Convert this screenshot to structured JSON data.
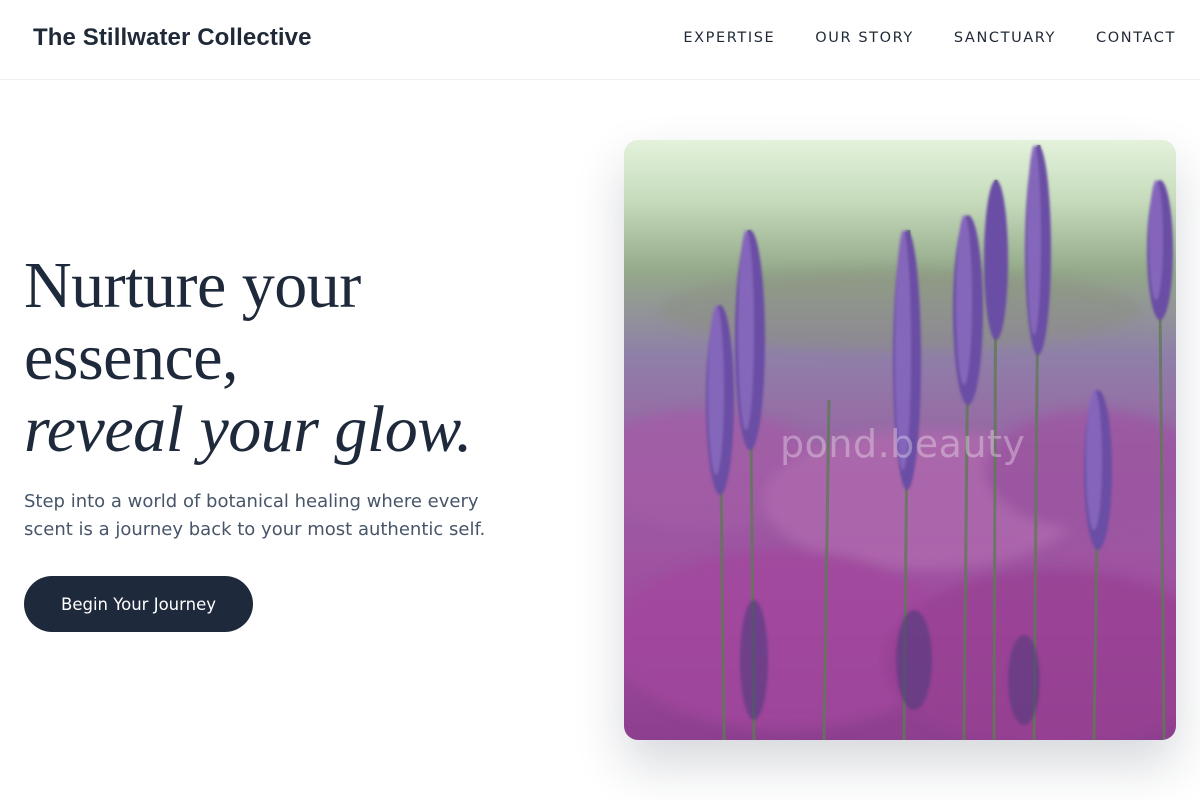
{
  "header": {
    "brand": "The Stillwater Collective",
    "nav": [
      {
        "label": "EXPERTISE"
      },
      {
        "label": "OUR STORY"
      },
      {
        "label": "SANCTUARY"
      },
      {
        "label": "CONTACT"
      }
    ]
  },
  "hero": {
    "headline_line1": "Nurture your",
    "headline_line2": "essence,",
    "headline_line3": "reveal your glow.",
    "subtitle": "Step into a world of botanical healing where every scent is a journey back to your most authentic self.",
    "cta_label": "Begin Your Journey",
    "image_watermark": "pond.beauty",
    "image_subject": "lavender-field-photo"
  },
  "colors": {
    "primary": "#1e293b",
    "text_muted": "#475569",
    "background": "#ffffff"
  }
}
